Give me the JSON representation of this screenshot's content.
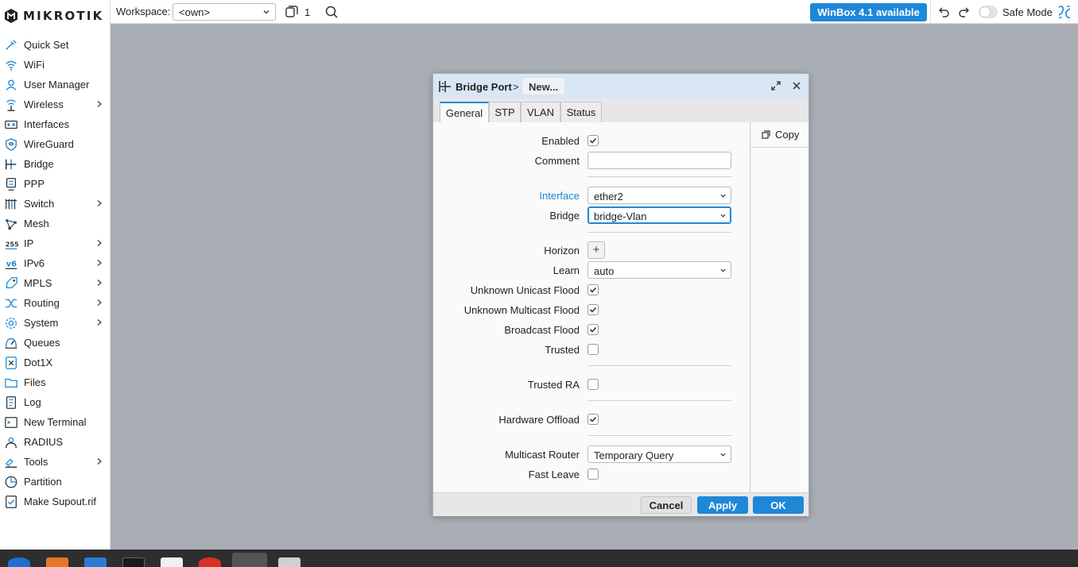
{
  "brand": {
    "name": "MIKROTIK"
  },
  "sidebar": {
    "items": [
      {
        "label": "Quick Set",
        "icon": "quick-set-icon",
        "submenu": false
      },
      {
        "label": "WiFi",
        "icon": "wifi-icon",
        "submenu": false
      },
      {
        "label": "User Manager",
        "icon": "user-manager-icon",
        "submenu": false
      },
      {
        "label": "Wireless",
        "icon": "wireless-icon",
        "submenu": true
      },
      {
        "label": "Interfaces",
        "icon": "interfaces-icon",
        "submenu": false
      },
      {
        "label": "WireGuard",
        "icon": "wireguard-icon",
        "submenu": false
      },
      {
        "label": "Bridge",
        "icon": "bridge-icon",
        "submenu": false
      },
      {
        "label": "PPP",
        "icon": "ppp-icon",
        "submenu": false
      },
      {
        "label": "Switch",
        "icon": "switch-icon",
        "submenu": true
      },
      {
        "label": "Mesh",
        "icon": "mesh-icon",
        "submenu": false
      },
      {
        "label": "IP",
        "icon": "ip-icon",
        "submenu": true
      },
      {
        "label": "IPv6",
        "icon": "ipv6-icon",
        "submenu": true
      },
      {
        "label": "MPLS",
        "icon": "mpls-icon",
        "submenu": true
      },
      {
        "label": "Routing",
        "icon": "routing-icon",
        "submenu": true
      },
      {
        "label": "System",
        "icon": "system-gear-icon",
        "submenu": true
      },
      {
        "label": "Queues",
        "icon": "queues-icon",
        "submenu": false
      },
      {
        "label": "Dot1X",
        "icon": "dot1x-icon",
        "submenu": false
      },
      {
        "label": "Files",
        "icon": "folder-icon",
        "submenu": false
      },
      {
        "label": "Log",
        "icon": "log-icon",
        "submenu": false
      },
      {
        "label": "New Terminal",
        "icon": "terminal-icon",
        "submenu": false
      },
      {
        "label": "RADIUS",
        "icon": "radius-icon",
        "submenu": false
      },
      {
        "label": "Tools",
        "icon": "tools-icon",
        "submenu": true
      },
      {
        "label": "Partition",
        "icon": "partition-icon",
        "submenu": false
      },
      {
        "label": "Make Supout.rif",
        "icon": "supout-icon",
        "submenu": false
      }
    ]
  },
  "topbar": {
    "workspace_label": "Workspace:",
    "workspace_value": "<own>",
    "window_count": "1",
    "update_button": "WinBox 4.1 available",
    "safe_mode_label": "Safe Mode",
    "safe_mode_on": false
  },
  "dialog": {
    "title": "Bridge Port",
    "breadcrumb_sep": ">",
    "subtitle": "New...",
    "tabs": [
      {
        "label": "General",
        "active": true
      },
      {
        "label": "STP",
        "active": false
      },
      {
        "label": "VLAN",
        "active": false
      },
      {
        "label": "Status",
        "active": false
      }
    ],
    "copy_label": "Copy",
    "fields": {
      "enabled": {
        "label": "Enabled",
        "checked": true
      },
      "comment": {
        "label": "Comment",
        "value": ""
      },
      "interface": {
        "label": "Interface",
        "value": "ether2"
      },
      "bridge": {
        "label": "Bridge",
        "value": "bridge-Vlan"
      },
      "horizon": {
        "label": "Horizon",
        "button": "+"
      },
      "learn": {
        "label": "Learn",
        "value": "auto"
      },
      "unknown_unicast_flood": {
        "label": "Unknown Unicast Flood",
        "checked": true
      },
      "unknown_multicast_flood": {
        "label": "Unknown Multicast Flood",
        "checked": true
      },
      "broadcast_flood": {
        "label": "Broadcast Flood",
        "checked": true
      },
      "trusted": {
        "label": "Trusted",
        "checked": false
      },
      "trusted_ra": {
        "label": "Trusted RA",
        "checked": false
      },
      "hardware_offload": {
        "label": "Hardware Offload",
        "checked": true
      },
      "multicast_router": {
        "label": "Multicast Router",
        "value": "Temporary Query"
      },
      "fast_leave": {
        "label": "Fast Leave",
        "checked": false
      }
    },
    "buttons": {
      "cancel": "Cancel",
      "apply": "Apply",
      "ok": "OK"
    }
  },
  "colors": {
    "accent": "#1e88d8",
    "desktop": "#a9adb4",
    "title_bar": "#d9e6f4",
    "taskbar": "#2e2e2e"
  }
}
